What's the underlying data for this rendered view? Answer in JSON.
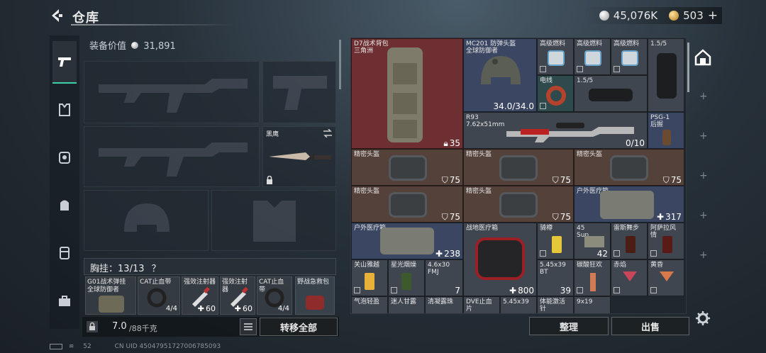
{
  "header": {
    "title": "仓库",
    "back_icon": "back-arrow-icon"
  },
  "currency": {
    "silver": "45,076K",
    "gold": "503",
    "plus": "+",
    "silver_color": "#c9c9c9",
    "gold_color": "#d9b05a"
  },
  "equip": {
    "value_label": "装备价值",
    "value": "31,891",
    "knife_name": "黑鹰",
    "chest_label": "胸挂",
    "chest_count": "13/13",
    "help": "？",
    "rig_items": [
      {
        "name": "G01战术弹挂",
        "sub": "全球防御者",
        "amount": ""
      },
      {
        "name": "CAT止血带",
        "sub": "",
        "amount": "4/4"
      },
      {
        "name": "强效注射器",
        "sub": "",
        "amount": "60"
      },
      {
        "name": "强效注射器",
        "sub": "",
        "amount": "60"
      },
      {
        "name": "CAT止血带",
        "sub": "",
        "amount": "4/4"
      },
      {
        "name": "野战急救包",
        "sub": "",
        "amount": ""
      }
    ],
    "weight": "7.0",
    "weight_max": "/88千克",
    "transfer_all": "转移全部"
  },
  "storage": {
    "items": [
      {
        "name": "D7战术背包",
        "sub": "三角洲",
        "amount": "35"
      },
      {
        "name": "MC201 防弹头盔",
        "sub": "全球防御者",
        "amount": "34.0/34.0"
      },
      {
        "name": "高级燃料",
        "sub": "",
        "amount": ""
      },
      {
        "name": "高级燃料",
        "sub": "",
        "amount": ""
      },
      {
        "name": "高级燃料",
        "sub": "",
        "amount": ""
      },
      {
        "name": "1.5/5",
        "sub": "",
        "amount": ""
      },
      {
        "name": "电线",
        "sub": "",
        "amount": ""
      },
      {
        "name": "1.5/5",
        "sub": "",
        "amount": ""
      },
      {
        "name": "R93",
        "sub": "7.62x51mm",
        "amount": "0/10"
      },
      {
        "name": "PSG-1",
        "sub": "后握",
        "amount": ""
      },
      {
        "name": "精密头盔",
        "sub": "",
        "amount": "75"
      },
      {
        "name": "精密头盔",
        "sub": "",
        "amount": "75"
      },
      {
        "name": "精密头盔",
        "sub": "",
        "amount": "75"
      },
      {
        "name": "精密头盔",
        "sub": "",
        "amount": "75"
      },
      {
        "name": "精密头盔",
        "sub": "",
        "amount": "75"
      },
      {
        "name": "户外医疗箱",
        "sub": "",
        "amount": "317"
      },
      {
        "name": "户外医疗箱",
        "sub": "",
        "amount": "238"
      },
      {
        "name": "战地医疗箱",
        "sub": "",
        "amount": "800"
      },
      {
        "name": "骑樽",
        "sub": "",
        "amount": ""
      },
      {
        "name": "45",
        "sub": "Sup",
        "amount": "42"
      },
      {
        "name": "雷斯舞步",
        "sub": "",
        "amount": ""
      },
      {
        "name": "阿萨拉风情",
        "sub": "",
        "amount": ""
      },
      {
        "name": "关山雅越",
        "sub": "",
        "amount": ""
      },
      {
        "name": "星光烟燥",
        "sub": "",
        "amount": ""
      },
      {
        "name": "4.6x30",
        "sub": "FMJ",
        "amount": "7"
      },
      {
        "name": "5.45x39",
        "sub": "BT",
        "amount": "39"
      },
      {
        "name": "碳酸狂欢",
        "sub": "",
        "amount": ""
      },
      {
        "name": "赤焰",
        "sub": "",
        "amount": ""
      },
      {
        "name": "黄昏",
        "sub": "",
        "amount": ""
      },
      {
        "name": "气泡轻盈",
        "sub": "",
        "amount": ""
      },
      {
        "name": "迷人甘露",
        "sub": "",
        "amount": ""
      },
      {
        "name": "清凝露珠",
        "sub": "",
        "amount": ""
      },
      {
        "name": "DVE止血片",
        "sub": "",
        "amount": ""
      },
      {
        "name": "5.45x39",
        "sub": "",
        "amount": ""
      },
      {
        "name": "体能激活针",
        "sub": "",
        "amount": ""
      },
      {
        "name": "9x19",
        "sub": "",
        "amount": ""
      }
    ],
    "arrange": "整理",
    "sell": "出售"
  },
  "status": {
    "battery": "52",
    "uid": "CN UID 45047951727006785093"
  }
}
